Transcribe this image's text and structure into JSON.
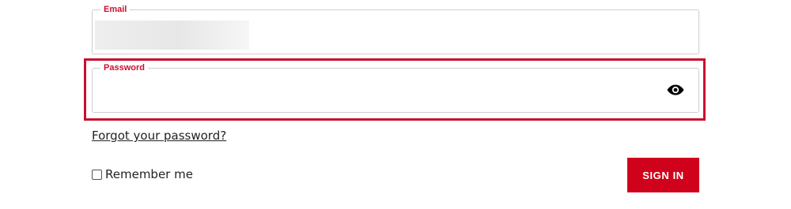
{
  "form": {
    "email": {
      "label": "Email",
      "value": ""
    },
    "password": {
      "label": "Password",
      "value": "",
      "toggle_icon": "eye-icon",
      "focused": true
    },
    "forgot_password_link": "Forgot your password?",
    "remember_me": {
      "label": "Remember me",
      "checked": false
    },
    "sign_in_label": "SIGN IN"
  },
  "colors": {
    "accent": "#c8102e",
    "button": "#d0021b",
    "border": "#cfcfcf",
    "text": "#222222"
  }
}
